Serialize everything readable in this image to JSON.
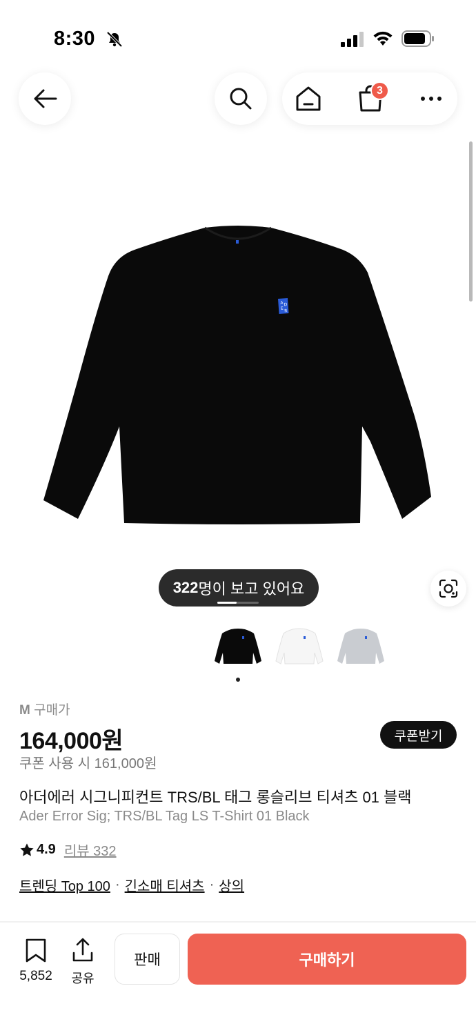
{
  "status_bar": {
    "time": "8:30"
  },
  "nav": {
    "cart_count": "3"
  },
  "gallery": {
    "viewers_count": "322",
    "viewers_suffix": "명이 보고 있어요",
    "thumbnails": [
      "black",
      "white",
      "gray"
    ],
    "selected_thumbnail": "black"
  },
  "product": {
    "size_prefix": "M",
    "size_suffix": "구매가",
    "price": "164,000원",
    "coupon_button": "쿠폰받기",
    "coupon_price": "쿠폰 사용 시 161,000원",
    "title_ko": "아더에러 시그니피컨트 TRS/BL 태그 롱슬리브 티셔츠 01 블랙",
    "title_en": "Ader Error Sig; TRS/BL Tag LS T-Shirt 01 Black",
    "rating": "4.9",
    "review_label": "리뷰 332",
    "tags": [
      "트렌딩 Top 100",
      "긴소매 티셔츠",
      "상의"
    ]
  },
  "bottom_bar": {
    "bookmark_count": "5,852",
    "share_label": "공유",
    "sell_label": "판매",
    "buy_label": "구매하기"
  },
  "colors": {
    "accent": "#ef6253",
    "badge": "#ef5a4a",
    "dark_pill": "#2b2b2b"
  }
}
